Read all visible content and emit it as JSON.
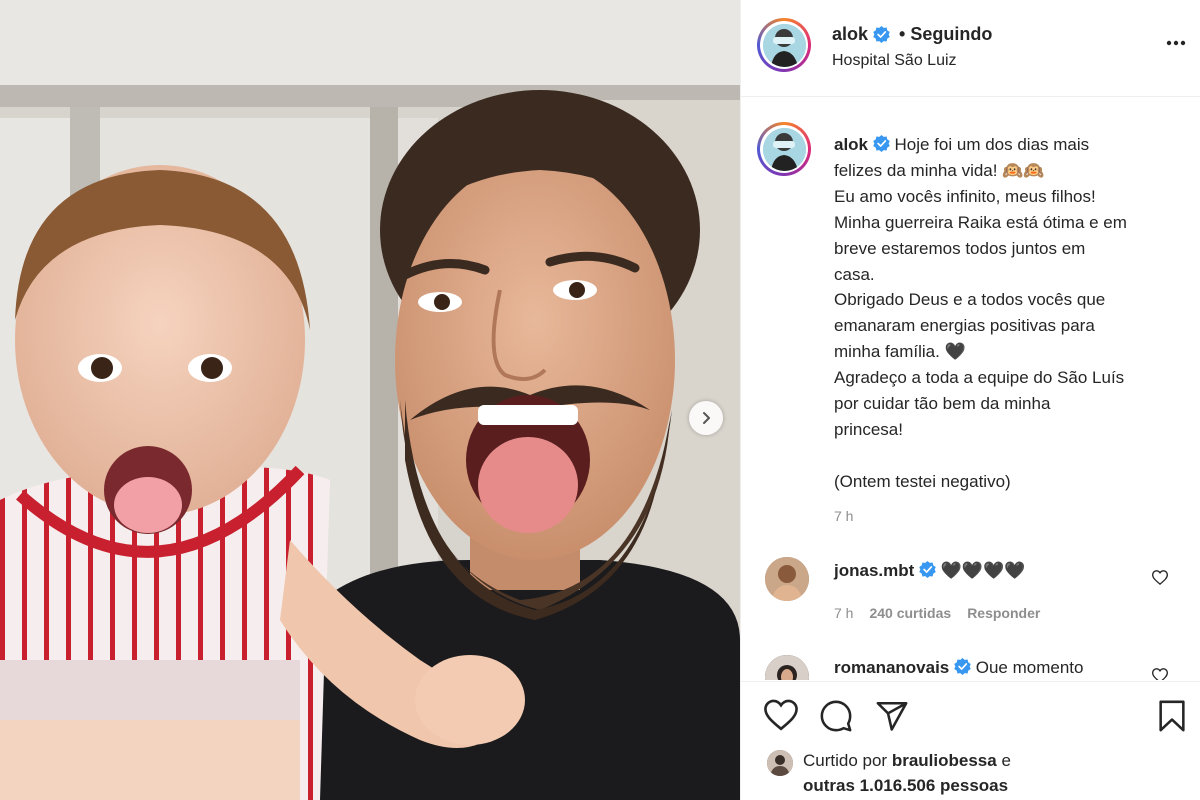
{
  "post": {
    "author": "alok",
    "follow_sep": "•",
    "follow_status": "Seguindo",
    "location": "Hospital São Luiz"
  },
  "caption": {
    "username": "alok",
    "lines": [
      "Hoje foi um dos dias mais",
      "felizes da minha vida! 🙉🙉",
      "Eu amo vocês infinito, meus filhos!",
      "Minha guerreira Raika está ótima e em",
      "breve estaremos todos juntos em",
      "casa.",
      "Obrigado Deus e a todos vocês que",
      "emanaram energias positivas para",
      "minha família. 🖤",
      "Agradeço a toda a equipe do São Luís",
      "por cuidar tão bem da minha",
      "princesa!",
      "",
      "(Ontem testei negativo)"
    ],
    "time": "7 h"
  },
  "comments": [
    {
      "username": "jonas.mbt",
      "text": "🖤🖤🖤🖤",
      "time": "7 h",
      "likes": "240 curtidas",
      "reply_label": "Responder"
    },
    {
      "username": "romananovais",
      "text": "Oue momento"
    }
  ],
  "likes": {
    "prefix": "Curtido por",
    "liker": "brauliobessa",
    "connector": "e",
    "others": "outras 1.016.506 pessoas"
  },
  "colors": {
    "verified": "#3897f0",
    "secondary_text": "#8e8e8e",
    "border": "#efefef"
  },
  "icons": [
    "verified-icon",
    "more-options-icon",
    "heart-icon",
    "comment-icon",
    "share-icon",
    "bookmark-icon",
    "next-arrow-icon"
  ]
}
